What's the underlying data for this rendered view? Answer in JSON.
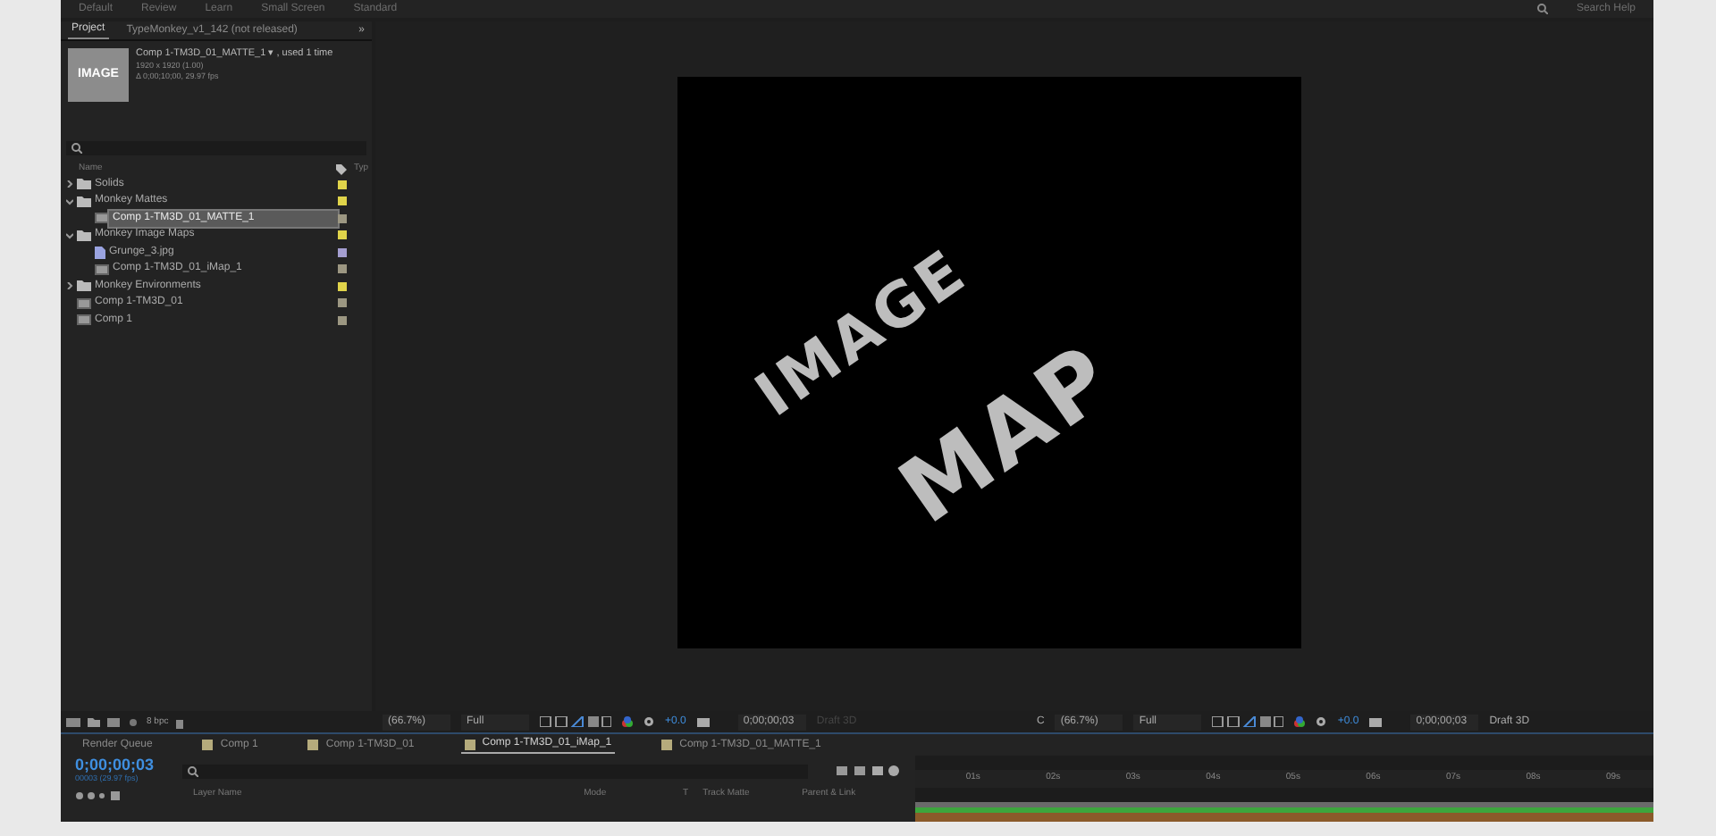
{
  "top_bar": {
    "workspaces": [
      "Default",
      "Review",
      "Learn",
      "Small Screen",
      "Standard"
    ],
    "search": "Search Help"
  },
  "project_panel": {
    "tabs": [
      {
        "label": "Project",
        "selected": true
      },
      {
        "label": "TypeMonkey_v1_142 (not released)",
        "selected": false
      }
    ],
    "overflow": "»",
    "thumbnail_text": "IMAGE",
    "info": {
      "name": "Comp 1-TM3D_01_MATTE_1 ▾ , used 1 time",
      "size": "1920 x 1920 (1.00)",
      "duration": "Δ 0;00;10;00, 29.97 fps"
    },
    "columns": [
      "Name",
      "Typ"
    ],
    "items": [
      {
        "kind": "folder",
        "label": "Solids",
        "expanded": false,
        "selected": false,
        "color": "#e0d44a"
      },
      {
        "kind": "folder",
        "label": "Monkey Mattes",
        "expanded": true,
        "selected": false,
        "color": "#e0d44a",
        "children": [
          {
            "kind": "comp",
            "label": "Comp 1-TM3D_01_MATTE_1",
            "selected": true,
            "color": "#9c9782"
          }
        ]
      },
      {
        "kind": "folder",
        "label": "Monkey Image Maps",
        "expanded": true,
        "selected": false,
        "color": "#e0d44a",
        "children": [
          {
            "kind": "image",
            "label": "Grunge_3.jpg",
            "selected": false,
            "color": "#a49ed0"
          },
          {
            "kind": "comp",
            "label": "Comp 1-TM3D_01_iMap_1",
            "selected": false,
            "color": "#9c9782"
          }
        ]
      },
      {
        "kind": "folder",
        "label": "Monkey Environments",
        "expanded": false,
        "selected": false,
        "color": "#e0d44a"
      },
      {
        "kind": "comp",
        "label": "Comp 1-TM3D_01",
        "selected": false,
        "color": "#9c9782"
      },
      {
        "kind": "comp",
        "label": "Comp 1",
        "selected": false,
        "color": "#9c9782"
      }
    ],
    "bpc": "8 bpc"
  },
  "viewer": {
    "lines": [
      "IMAGE",
      "MAP"
    ]
  },
  "viewer_toolbars": [
    {
      "zoom": "(66.7%)",
      "resolution": "Full",
      "exposure": "+0.0",
      "timecode": "0;00;00;03",
      "renderer": "Draft 3D",
      "renderer_dim": true
    },
    {
      "lead": "C",
      "zoom": "(66.7%)",
      "resolution": "Full",
      "exposure": "+0.0",
      "timecode": "0;00;00;03",
      "renderer": "Draft 3D",
      "renderer_dim": false
    }
  ],
  "timeline_tabs": [
    {
      "label": "Render Queue",
      "selected": false,
      "kind": "queue"
    },
    {
      "label": "Comp 1",
      "selected": false,
      "kind": "comp"
    },
    {
      "label": "Comp 1-TM3D_01",
      "selected": false,
      "kind": "comp"
    },
    {
      "label": "Comp 1-TM3D_01_iMap_1",
      "selected": true,
      "kind": "comp"
    },
    {
      "label": "Comp 1-TM3D_01_MATTE_1",
      "selected": false,
      "kind": "comp"
    }
  ],
  "timeline": {
    "timecode": "0;00;00;03",
    "frames": "00003 (29.97 fps)",
    "columns": [
      "Layer Name",
      "Mode",
      "T",
      "Track Matte",
      "Parent & Link"
    ],
    "ruler": [
      "01s",
      "02s",
      "03s",
      "04s",
      "05s",
      "06s",
      "07s",
      "08s",
      "09s"
    ]
  }
}
